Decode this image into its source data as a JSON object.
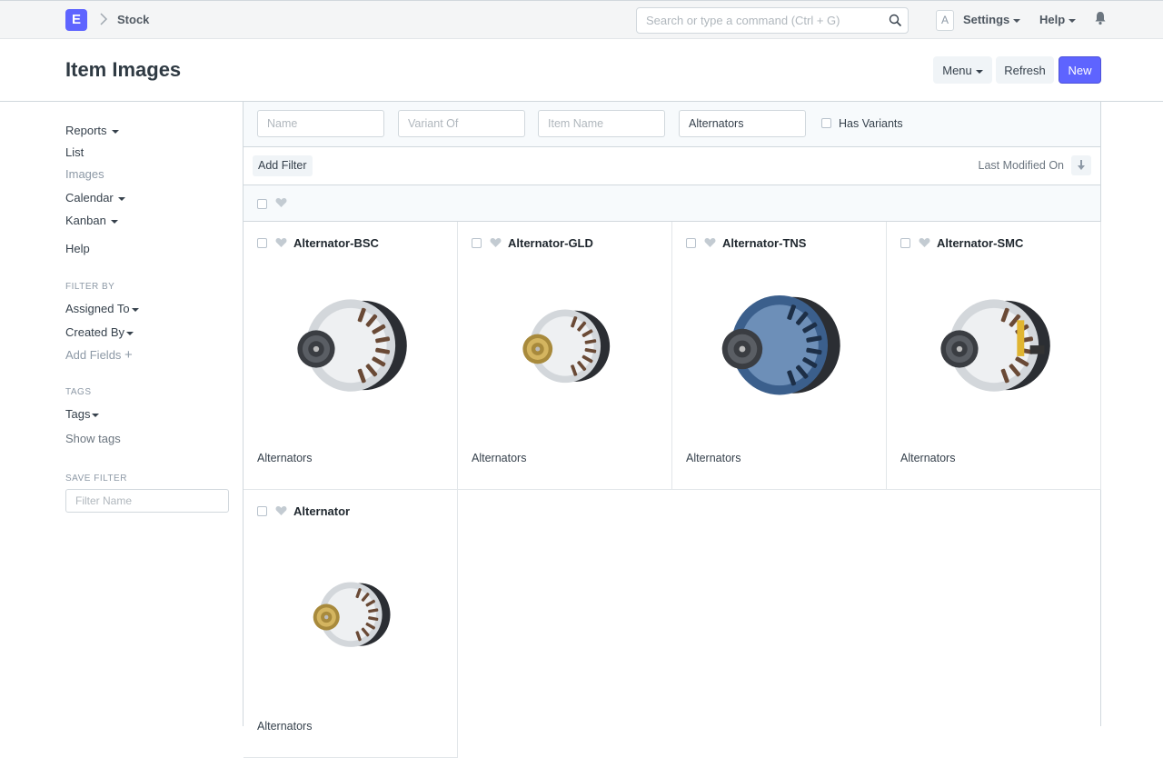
{
  "navbar": {
    "logo_letter": "E",
    "breadcrumb": "Stock",
    "search_placeholder": "Search or type a command (Ctrl + G)",
    "avatar_letter": "A",
    "settings_label": "Settings",
    "help_label": "Help"
  },
  "page": {
    "title": "Item Images",
    "menu_label": "Menu",
    "refresh_label": "Refresh",
    "new_label": "New"
  },
  "sidebar": {
    "reports": "Reports",
    "list": "List",
    "images": "Images",
    "calendar": "Calendar",
    "kanban": "Kanban",
    "help": "Help",
    "filter_by_heading": "FILTER BY",
    "assigned_to": "Assigned To",
    "created_by": "Created By",
    "add_fields": "Add Fields",
    "tags_heading": "TAGS",
    "tags": "Tags",
    "show_tags": "Show tags",
    "save_filter_heading": "SAVE FILTER",
    "filter_name_placeholder": "Filter Name"
  },
  "filters": {
    "name_placeholder": "Name",
    "variant_of_placeholder": "Variant Of",
    "item_name_placeholder": "Item Name",
    "item_group_value": "Alternators",
    "has_variants_label": "Has Variants",
    "add_filter_label": "Add Filter",
    "sort_label": "Last Modified On"
  },
  "cards": [
    {
      "title": "Alternator-BSC",
      "group": "Alternators",
      "style": "silver-black"
    },
    {
      "title": "Alternator-GLD",
      "group": "Alternators",
      "style": "gold-pulley"
    },
    {
      "title": "Alternator-TNS",
      "group": "Alternators",
      "style": "blue"
    },
    {
      "title": "Alternator-SMC",
      "group": "Alternators",
      "style": "silver-yellow"
    },
    {
      "title": "Alternator",
      "group": "Alternators",
      "style": "small-gold"
    }
  ],
  "colors": {
    "primary": "#5e64ff",
    "navbar_bg": "#f4f5f6",
    "border": "#d1d8dd"
  }
}
